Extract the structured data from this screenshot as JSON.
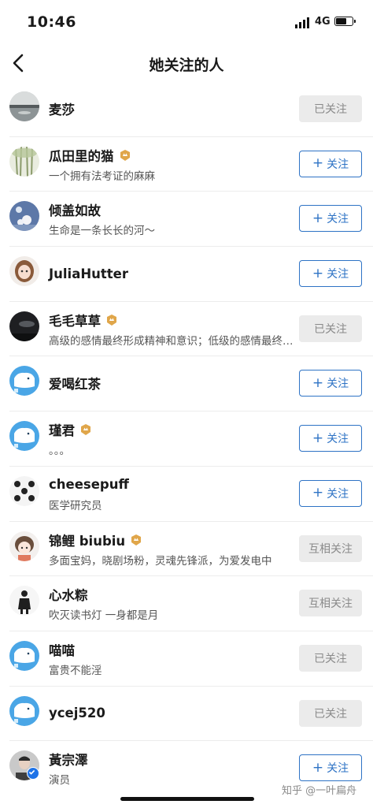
{
  "status_bar": {
    "time": "10:46",
    "network": "4G"
  },
  "header": {
    "title": "她关注的人"
  },
  "users": [
    {
      "name": "麦莎",
      "bio": "",
      "button": "已关注",
      "state": "followed",
      "badge": false,
      "verified": false,
      "avatar": "lake-avatar"
    },
    {
      "name": "瓜田里的猫",
      "bio": "一个拥有法考证的麻麻",
      "button": "关注",
      "state": "follow",
      "badge": true,
      "verified": false,
      "avatar": "bamboo-avatar"
    },
    {
      "name": "倾盖如故",
      "bio": "生命是一条长长的河～",
      "button": "关注",
      "state": "follow",
      "badge": false,
      "verified": false,
      "avatar": "blue-art-avatar"
    },
    {
      "name": "JuliaHutter",
      "bio": "",
      "button": "关注",
      "state": "follow",
      "badge": false,
      "verified": false,
      "avatar": "cartoon-girl-avatar"
    },
    {
      "name": "毛毛草草",
      "bio": "高级的感情最终形成精神和意识；低级的感情最终形成",
      "button": "已关注",
      "state": "followed",
      "badge": true,
      "verified": false,
      "avatar": "night-sky-avatar"
    },
    {
      "name": "爱喝红茶",
      "bio": "",
      "button": "关注",
      "state": "follow",
      "badge": false,
      "verified": false,
      "avatar": "default-avatar"
    },
    {
      "name": "瑾君",
      "bio": "。。。",
      "button": "关注",
      "state": "follow",
      "badge": true,
      "verified": false,
      "avatar": "default-avatar"
    },
    {
      "name": "cheesepuff",
      "bio": "医学研究员",
      "button": "关注",
      "state": "follow",
      "badge": false,
      "verified": false,
      "avatar": "pattern-avatar"
    },
    {
      "name": "锦鲤 biubiu",
      "bio": "多面宝妈，晓剧场粉，灵魂先锋派，为爱发电中",
      "button": "互相关注",
      "state": "followed",
      "badge": true,
      "verified": false,
      "avatar": "anime-avatar"
    },
    {
      "name": "心水粽",
      "bio": "吹灭读书灯  一身都是月",
      "button": "互相关注",
      "state": "followed",
      "badge": false,
      "verified": false,
      "avatar": "figure-avatar"
    },
    {
      "name": "喵喵",
      "bio": "富贵不能淫",
      "button": "已关注",
      "state": "followed",
      "badge": false,
      "verified": false,
      "avatar": "default-avatar"
    },
    {
      "name": "ycej520",
      "bio": "",
      "button": "已关注",
      "state": "followed",
      "badge": false,
      "verified": false,
      "avatar": "default-avatar"
    },
    {
      "name": "黃宗澤",
      "bio": "演员",
      "button": "关注",
      "state": "follow",
      "badge": false,
      "verified": true,
      "avatar": "portrait-avatar"
    }
  ],
  "watermark": "知乎 @一叶扁舟",
  "colors": {
    "accent": "#2e73c5",
    "followed_bg": "#ebebeb",
    "badge": "#e0a64a"
  }
}
